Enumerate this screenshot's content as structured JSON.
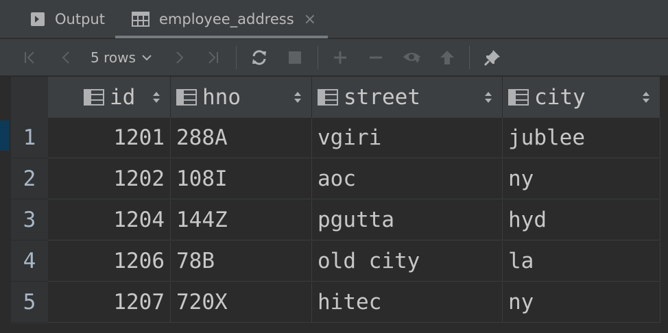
{
  "tabs": [
    {
      "label": "Output",
      "icon": "console-icon"
    },
    {
      "label": "employee_address",
      "icon": "table-icon",
      "close": "×"
    }
  ],
  "toolbar": {
    "rows_label": "5 rows",
    "buttons": [
      "first-page",
      "previous-page",
      "next-page",
      "last-page",
      "reload",
      "stop",
      "add-row",
      "delete-row",
      "preview-changes",
      "submit",
      "pin"
    ]
  },
  "table": {
    "columns": [
      "id",
      "hno",
      "street",
      "city"
    ],
    "rows": [
      {
        "num": "1",
        "id": "1201",
        "hno": "288A",
        "street": "vgiri",
        "city": "jublee"
      },
      {
        "num": "2",
        "id": "1202",
        "hno": "108I",
        "street": "aoc",
        "city": "ny"
      },
      {
        "num": "3",
        "id": "1204",
        "hno": "144Z",
        "street": "pgutta",
        "city": "hyd"
      },
      {
        "num": "4",
        "id": "1206",
        "hno": "78B",
        "street": "old city",
        "city": "la"
      },
      {
        "num": "5",
        "id": "1207",
        "hno": "720X",
        "street": "hitec",
        "city": "ny"
      }
    ]
  },
  "colors": {
    "background": "#2b2b2b",
    "panel": "#3c3f41",
    "text": "#c8c8c8",
    "selection": "#0d3a58"
  }
}
